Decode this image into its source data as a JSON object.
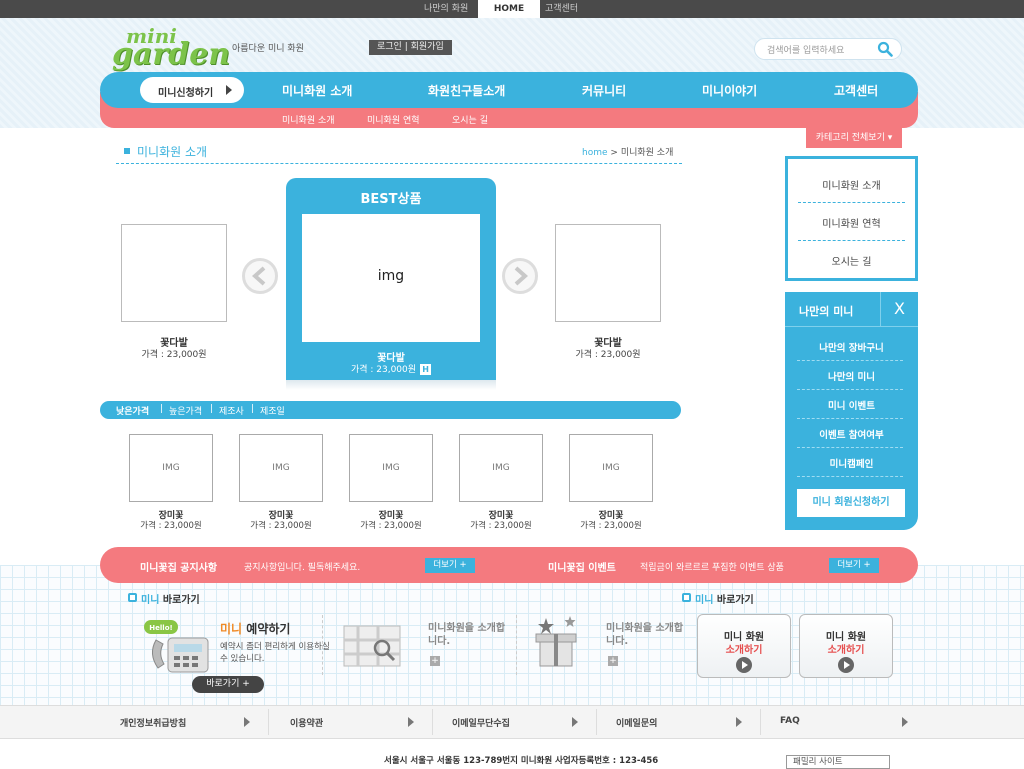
{
  "topbar": {
    "my_member": "나만의 화원",
    "home": "HOME",
    "support": "고객센터"
  },
  "header": {
    "logo_mini": "mini",
    "logo_garden": "garden",
    "tagline": "아름다운 미니 화원",
    "login": "로그인",
    "join": "회원가입",
    "search_placeholder": "검색어를 입력하세요"
  },
  "nav": {
    "apply": "미니신청하기",
    "items": [
      "미니화원 소개",
      "화원친구들소개",
      "커뮤니티",
      "미니이야기",
      "고객센터"
    ],
    "subitems": [
      "미니화원 소개",
      "미니화원 연혁",
      "오시는 길"
    ]
  },
  "category_button": "카테고리 전체보기 ▾",
  "page": {
    "title": "미니화원 소개",
    "breadcrumb_home": "home",
    "breadcrumb_sep": ">",
    "breadcrumb_current": "미니화원 소개"
  },
  "carousel": {
    "best_title": "BEST상품",
    "best_img": "img",
    "best_name": "꽃다발",
    "best_price": "가격 : 23,000원",
    "best_badge": "H",
    "left_name": "꽃다발",
    "left_price": "가격 : 23,000원",
    "right_name": "꽃다발",
    "right_price": "가격 : 23,000원"
  },
  "sortbar": [
    "낮은가격",
    "높은가격",
    "제조사",
    "제조일"
  ],
  "sort_divider": "|",
  "products": [
    {
      "img": "IMG",
      "name": "장미꽃",
      "price": "가격 : 23,000원"
    },
    {
      "img": "IMG",
      "name": "장미꽃",
      "price": "가격 : 23,000원"
    },
    {
      "img": "IMG",
      "name": "장미꽃",
      "price": "가격 : 23,000원"
    },
    {
      "img": "IMG",
      "name": "장미꽃",
      "price": "가격 : 23,000원"
    },
    {
      "img": "IMG",
      "name": "장미꽃",
      "price": "가격 : 23,000원"
    }
  ],
  "sidebar": {
    "categories": [
      "미니화원 소개",
      "미니화원 연혁",
      "오시는 길"
    ],
    "my_title": "나만의 미니",
    "my_close": "X",
    "my_items": [
      "나만의 장바구니",
      "나만의 미니",
      "미니 이벤트",
      "이벤트 참여여부",
      "미니캠페인"
    ],
    "my_apply": "미니 회원신청하기"
  },
  "notice": {
    "notice_title": "미니꽃집 공지사항",
    "notice_text": "공지사항입니다. 필독해주세요.",
    "event_title": "미니꽃집 이벤트",
    "event_text": "적립금이 와르르르 푸짐한 이벤트 상품",
    "more": "더보기 +"
  },
  "shortcuts": {
    "title_mini": "미니",
    "title_rest": "바로가기",
    "hello_tag": "Hello!",
    "reserve_mini": "미니",
    "reserve_rest": "예약하기",
    "reserve_desc": "예약시 좀더 편리하게 이용하실 수 있습니다.",
    "reserve_btn": "바로가기 +",
    "intro1": "미니화원을 소개합니다.",
    "intro2": "미니화원을 소개합니다.",
    "plus": "+"
  },
  "quick_cards": [
    {
      "l1": "미니 화원",
      "l2": "소개하기"
    },
    {
      "l1": "미니 화원",
      "l2": "소개하기"
    }
  ],
  "footer": {
    "links": [
      "개인정보취급방침",
      "이용약관",
      "이메일무단수집",
      "이메일문의",
      "FAQ"
    ],
    "address": "서울시 서울구 서울동 123-789번지 미니화원 사업자등록번호 : 123-456",
    "family_site": "패밀리 사이트"
  },
  "colors": {
    "blue": "#3bb2dd",
    "pink": "#f47a7f",
    "green": "#7cc34a"
  }
}
